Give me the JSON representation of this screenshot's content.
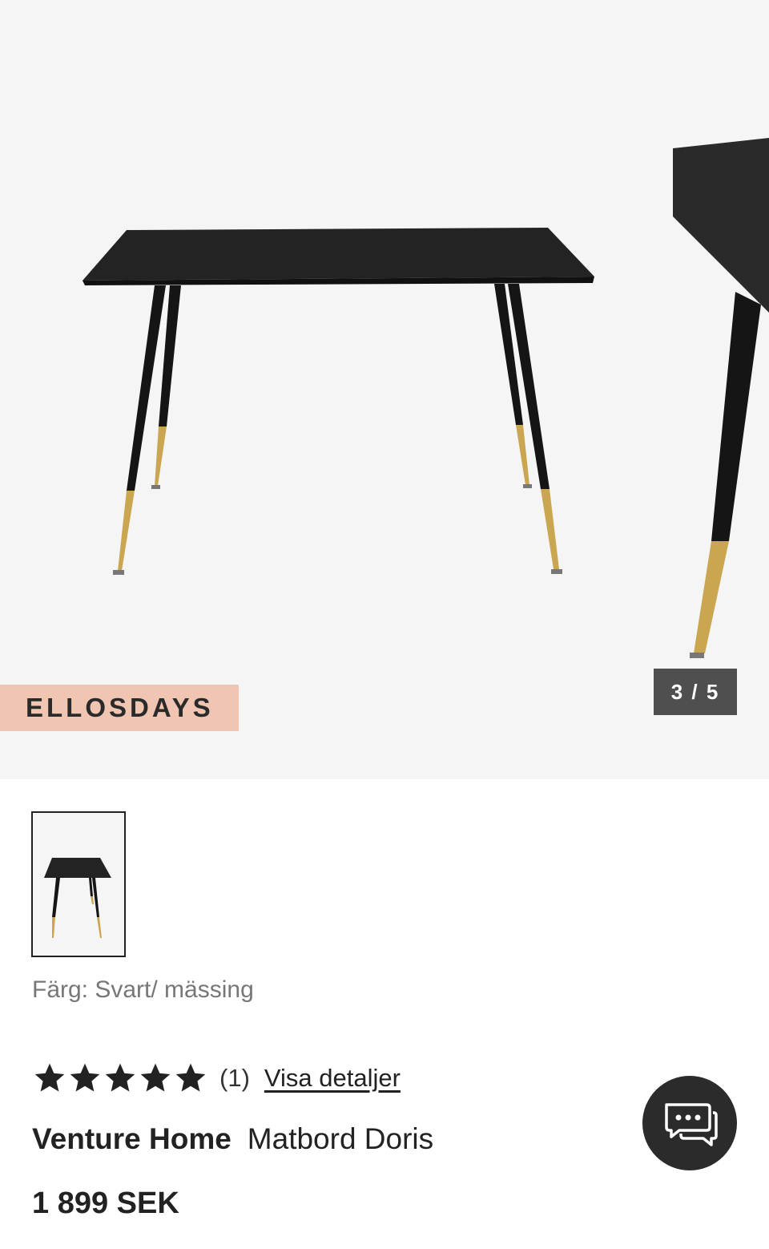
{
  "gallery": {
    "promo_badge": "ELLOSDAYS",
    "counter": "3 / 5",
    "main_image_icon": "dining-table-image",
    "next_image_icon": "dining-table-closeup-image"
  },
  "thumbnail": {
    "icon": "dining-table-thumbnail"
  },
  "color": {
    "text": "Färg: Svart/ mässing"
  },
  "rating": {
    "stars": 5,
    "max_stars": 5,
    "count": "(1)",
    "details_link": "Visa detaljer"
  },
  "product": {
    "brand": "Venture Home",
    "name": "Matbord Doris",
    "price": "1 899 SEK"
  },
  "chat": {
    "icon": "chat-bubbles-icon"
  },
  "colors": {
    "gallery_background": "#f5f5f5",
    "promo_badge": "#f0c6b2",
    "counter_background": "#4f4f4f",
    "chat_button": "#2b2b2b",
    "brass": "#c9a64f"
  }
}
